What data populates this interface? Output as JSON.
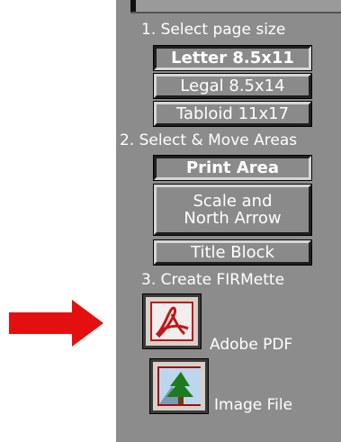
{
  "step1": {
    "title": "1. Select page size",
    "options": [
      "Letter 8.5x11",
      "Legal 8.5x14",
      "Tabloid 11x17"
    ],
    "selected": "Letter 8.5x11"
  },
  "step2": {
    "title": "2. Select & Move Areas",
    "options": [
      "Print Area",
      "Scale and\nNorth Arrow",
      "Title Block"
    ],
    "selected": "Print Area"
  },
  "step3": {
    "title": "3. Create FIRMette",
    "pdf_label": "Adobe PDF",
    "image_label": "Image File",
    "pdf_icon": "adobe-pdf-icon",
    "image_icon": "tree-image-icon"
  },
  "colors": {
    "panel_bg": "#8c8c8c",
    "arrow": "#e41010",
    "text": "#ffffff"
  }
}
